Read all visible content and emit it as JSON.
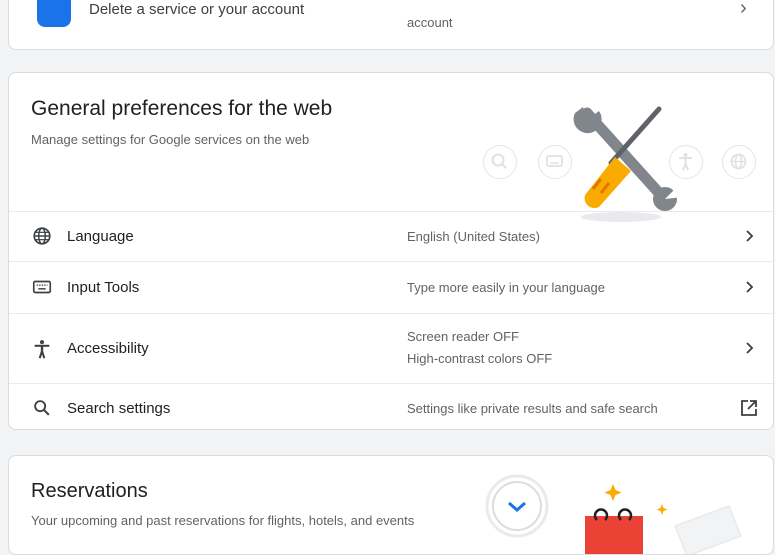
{
  "top_card": {
    "title": "Delete a service or your account",
    "value": "account",
    "chevron": "chevron-right-icon"
  },
  "prefs_card": {
    "title": "General preferences for the web",
    "subtitle": "Manage settings for Google services on the web",
    "illustration": "tools-illustration",
    "rows": [
      {
        "icon": "globe-icon",
        "label": "Language",
        "value": "English (United States)",
        "action": "chevron-right-icon"
      },
      {
        "icon": "keyboard-icon",
        "label": "Input Tools",
        "value": "Type more easily in your language",
        "action": "chevron-right-icon"
      },
      {
        "icon": "accessibility-icon",
        "label": "Accessibility",
        "value": "Screen reader OFF",
        "value2": "High-contrast colors OFF",
        "action": "chevron-right-icon"
      },
      {
        "icon": "search-icon",
        "label": "Search settings",
        "value": "Settings like private results and safe search",
        "action": "open-in-new-icon"
      }
    ]
  },
  "reservations_card": {
    "title": "Reservations",
    "subtitle": "Your upcoming and past reservations for flights, hotels, and events",
    "illustration": "reservations-illustration"
  },
  "colors": {
    "background": "#f1f3f4",
    "card_border": "#dadce0",
    "accent_blue": "#1a73e8",
    "tool_yellow": "#f9ab00",
    "tool_gray": "#5f6368",
    "red": "#ea4335"
  }
}
